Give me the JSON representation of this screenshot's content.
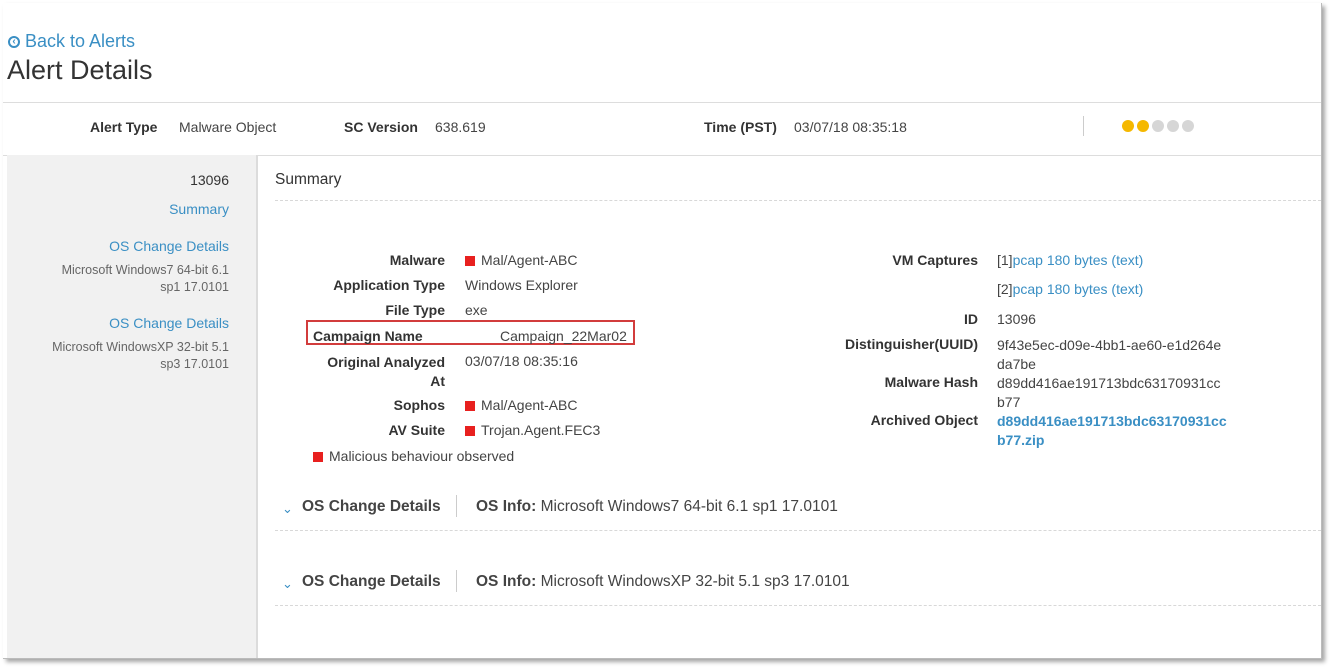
{
  "nav": {
    "back_label": "Back to Alerts",
    "back_icon": "circle-arrow-left-icon"
  },
  "page": {
    "title": "Alert Details"
  },
  "header": {
    "alert_type_label": "Alert Type",
    "alert_type_value": "Malware Object",
    "sc_version_label": "SC Version",
    "sc_version_value": "638.619",
    "time_label": "Time (PST)",
    "time_value": "03/07/18 08:35:18",
    "severity_level": 2,
    "severity_max": 5,
    "severity_color": "#f5b800"
  },
  "sidebar": {
    "id": "13096",
    "summary_link": "Summary",
    "os_sections": [
      {
        "link": "OS Change Details",
        "info_line1": "Microsoft Windows7 64-bit 6.1",
        "info_line2": "sp1 17.0101"
      },
      {
        "link": "OS Change Details",
        "info_line1": "Microsoft WindowsXP 32-bit 5.1",
        "info_line2": "sp3 17.0101"
      }
    ]
  },
  "summary": {
    "title": "Summary",
    "malware_label": "Malware",
    "malware_value": "Mal/Agent-ABC",
    "app_type_label": "Application Type",
    "app_type_value": "Windows Explorer",
    "file_type_label": "File Type",
    "file_type_value": "exe",
    "campaign_label": "Campaign Name",
    "campaign_value": "Campaign_22Mar02",
    "analyzed_label_1": "Original Analyzed",
    "analyzed_label_2": "At",
    "analyzed_value": "03/07/18 08:35:16",
    "sophos_label": "Sophos",
    "sophos_value": "Mal/Agent-ABC",
    "av_label": "AV Suite",
    "av_value": "Trojan.Agent.FEC3",
    "malicious_note": "Malicious behaviour observed",
    "vm_label": "VM Captures",
    "vm_captures": [
      {
        "index": "[1]",
        "link": "pcap 180 bytes (text)"
      },
      {
        "index": "[2]",
        "link": "pcap 180 bytes (text)"
      }
    ],
    "id_label": "ID",
    "id_value": "13096",
    "uuid_label": "Distinguisher(UUID)",
    "uuid_line1": "9f43e5ec-d09e-4bb1-ae60-e1d264e",
    "uuid_line2": "da7be",
    "hash_label": "Malware Hash",
    "hash_line1": "d89dd416ae191713bdc63170931cc",
    "hash_line2": "b77",
    "archive_label": "Archived Object",
    "archive_line1": "d89dd416ae191713bdc63170931cc",
    "archive_line2": "b77.zip",
    "threat_color": "#e8201f"
  },
  "os_details": [
    {
      "title": "OS Change Details",
      "info_label": "OS Info:",
      "info_value": "Microsoft Windows7 64-bit 6.1 sp1 17.0101"
    },
    {
      "title": "OS Change Details",
      "info_label": "OS Info:",
      "info_value": "Microsoft WindowsXP 32-bit 5.1 sp3 17.0101"
    }
  ]
}
